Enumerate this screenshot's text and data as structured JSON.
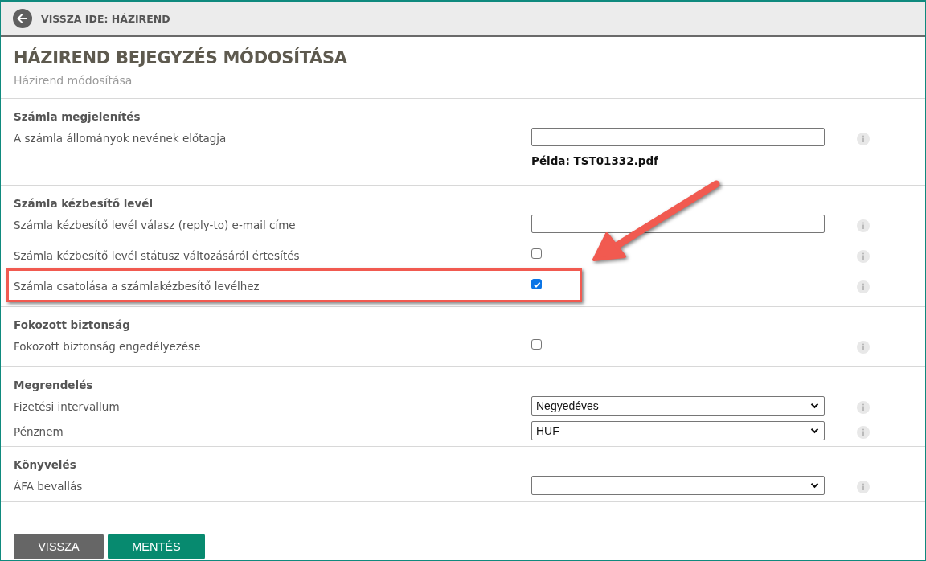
{
  "back_link": "VISSZA IDE: HÁZIREND",
  "title": "HÁZIREND BEJEGYZÉS MÓDOSÍTÁSA",
  "subtitle": "Házirend módosítása",
  "sections": [
    {
      "heading": "Számla megjelenítés",
      "rows": [
        {
          "kind": "text",
          "label": "A számla állományok nevének előtagja",
          "hint": "Példa: TST01332.pdf",
          "highlighted": false
        }
      ]
    },
    {
      "heading": "Számla kézbesítő levél",
      "rows": [
        {
          "kind": "text",
          "label": "Számla kézbesítő levél válasz (reply-to) e-mail címe",
          "highlighted": false
        },
        {
          "kind": "checkbox",
          "label": "Számla kézbesítő levél státusz változásáról értesítés",
          "checked": false,
          "highlighted": false
        },
        {
          "kind": "checkbox",
          "label": "Számla csatolása a számlakézbesítő levélhez",
          "checked": true,
          "highlighted": true
        }
      ]
    },
    {
      "heading": "Fokozott biztonság",
      "rows": [
        {
          "kind": "checkbox",
          "label": "Fokozott biztonság engedélyezése",
          "checked": false,
          "highlighted": false
        }
      ]
    },
    {
      "heading": "Megrendelés",
      "rows": [
        {
          "kind": "select",
          "label": "Fizetési intervallum",
          "value": "Negyedéves",
          "highlighted": false
        },
        {
          "kind": "select",
          "label": "Pénznem",
          "value": "HUF",
          "highlighted": false
        }
      ]
    },
    {
      "heading": "Könyvelés",
      "rows": [
        {
          "kind": "select",
          "label": "ÁFA bevallás",
          "highlighted": false
        }
      ]
    }
  ],
  "buttons": [
    {
      "label": "VISSZA",
      "kind": "secondary"
    },
    {
      "label": "MENTÉS",
      "kind": "primary"
    }
  ]
}
